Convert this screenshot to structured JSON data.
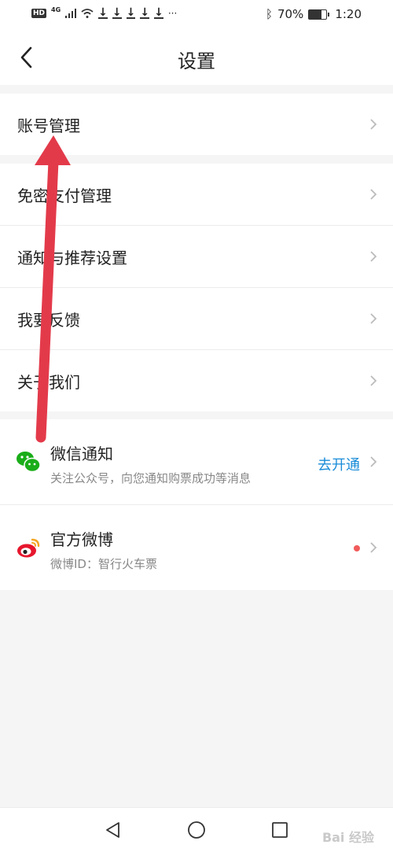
{
  "statusbar": {
    "hd": "HD",
    "network": "4G",
    "battery_percent": "70%",
    "battery_level": 0.7,
    "time": "1:20",
    "icons": [
      "hd-icon",
      "signal-icon",
      "wifi-icon",
      "download-icon",
      "more-icon",
      "bluetooth-icon",
      "battery-icon"
    ]
  },
  "header": {
    "title": "设置"
  },
  "groups": {
    "account": [
      {
        "label": "账号管理"
      }
    ],
    "settings": [
      {
        "label": "免密支付管理"
      },
      {
        "label": "通知与推荐设置"
      },
      {
        "label": "我要反馈"
      },
      {
        "label": "关于我们"
      }
    ]
  },
  "social": {
    "wechat": {
      "title": "微信通知",
      "subtitle": "关注公众号，向您通知购票成功等消息",
      "action": "去开通",
      "color": "#1aad19"
    },
    "weibo": {
      "title": "官方微博",
      "subtitle": "微博ID：智行火车票",
      "color": "#e6162d"
    }
  },
  "colors": {
    "accent": "#1a8cd8",
    "annotation_arrow": "#e33a4a"
  },
  "watermark": "Bai 经验"
}
